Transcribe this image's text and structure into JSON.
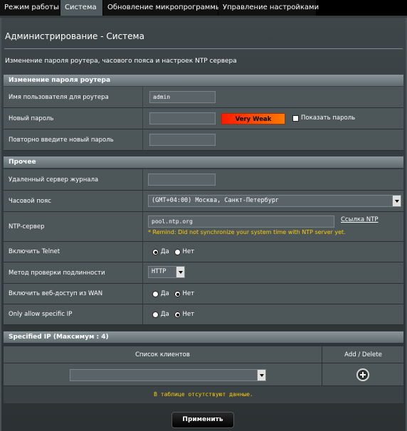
{
  "tabs": [
    {
      "label": "Режим работы",
      "active": false
    },
    {
      "label": "Система",
      "active": true
    },
    {
      "label": "Обновление микропрограммы",
      "active": false
    },
    {
      "label": "Управление настройками",
      "active": false
    }
  ],
  "page": {
    "title": "Администрирование - Система",
    "description": "Изменение пароля роутера, часового пояса и настроек NTP сервера"
  },
  "password_section": {
    "header": "Изменение пароля роутера",
    "username_label": "Имя пользователя для роутера",
    "username_value": "admin",
    "new_password_label": "Новый пароль",
    "strength": "Very Weak",
    "show_password_label": "Показать пароль",
    "confirm_label": "Повторно введите новый пароль"
  },
  "misc_section": {
    "header": "Прочее",
    "syslog_label": "Удаленный сервер журнала",
    "timezone_label": "Часовой пояс",
    "timezone_value": "(GMT+04:00) Москва, Санкт-Петербург",
    "ntp_label": "NTP-сервер",
    "ntp_value": "pool.ntp.org",
    "ntp_link": "Ссылка NTP",
    "ntp_remind": "* Remind: Did not synchronize your system time with NTP server yet.",
    "telnet_label": "Включить Telnet",
    "telnet_value": "yes",
    "auth_label": "Метод проверки подлинности",
    "auth_value": "HTTP",
    "wan_label": "Включить веб-доступ из WAN",
    "wan_value": "no",
    "specific_ip_label": "Only allow specific IP",
    "specific_ip_value": "no",
    "yes_label": "Да",
    "no_label": "Нет"
  },
  "specified_ip": {
    "header": "Specified IP (Максимум : 4)",
    "col_clients": "Список клиентов",
    "col_add_delete": "Add / Delete",
    "empty_text": "В таблице отсутствуют данные."
  },
  "apply_label": "Применить",
  "colors": {
    "accent_strength": "#ff3a00",
    "remind": "#ffcc00",
    "active_tab": "#4f5a5e"
  }
}
